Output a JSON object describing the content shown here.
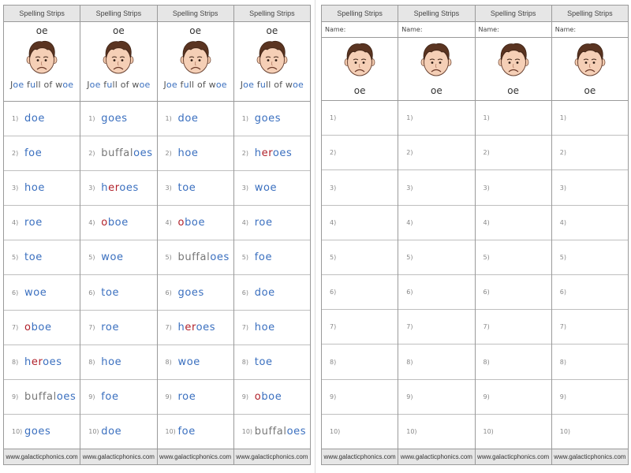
{
  "strip_title": "Spelling Strips",
  "footer_url": "www.galacticphonics.com",
  "sound": "oe",
  "phrase": [
    {
      "t": "J",
      "c": "grey"
    },
    {
      "t": "oe",
      "c": "blue"
    },
    {
      "t": " f",
      "c": "grey"
    },
    {
      "t": "u",
      "c": "blue"
    },
    {
      "t": "ll of w",
      "c": "grey"
    },
    {
      "t": "oe",
      "c": "blue"
    }
  ],
  "name_label": "Name:",
  "colors": {
    "blue": "#3a6fbf",
    "red": "#b0202a",
    "grey": "#777777",
    "header_bg": "#e6e6e6"
  },
  "icons": {
    "face": "sad-face-icon"
  },
  "numbers": [
    "1)",
    "2)",
    "3)",
    "4)",
    "5)",
    "6)",
    "7)",
    "8)",
    "9)",
    "10)"
  ],
  "left_strips": [
    [
      "doe",
      "foe",
      "hoe",
      "roe",
      "toe",
      "woe",
      "oboe",
      "heroes",
      "buffaloes",
      "goes"
    ],
    [
      "goes",
      "buffaloes",
      "heroes",
      "oboe",
      "woe",
      "toe",
      "roe",
      "hoe",
      "foe",
      "doe"
    ],
    [
      "doe",
      "hoe",
      "toe",
      "oboe",
      "buffaloes",
      "goes",
      "heroes",
      "woe",
      "roe",
      "foe"
    ],
    [
      "goes",
      "heroes",
      "woe",
      "roe",
      "foe",
      "doe",
      "hoe",
      "toe",
      "oboe",
      "buffaloes"
    ]
  ]
}
